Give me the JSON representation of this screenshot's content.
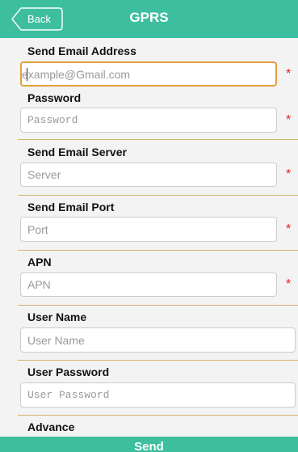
{
  "header": {
    "back_label": "Back",
    "title": "GPRS"
  },
  "form": {
    "send_email_address": {
      "label": "Send Email Address",
      "placeholder": "example@Gmail.com",
      "value": "",
      "required_mark": "*"
    },
    "password": {
      "label": "Password",
      "placeholder": "Password",
      "value": "",
      "required_mark": "*"
    },
    "send_email_server": {
      "label": "Send Email Server",
      "placeholder": "Server",
      "value": "",
      "required_mark": "*"
    },
    "send_email_port": {
      "label": "Send Email Port",
      "placeholder": "Port",
      "value": "",
      "required_mark": "*"
    },
    "apn": {
      "label": "APN",
      "placeholder": "APN",
      "value": "",
      "required_mark": "*"
    },
    "user_name": {
      "label": "User Name",
      "placeholder": "User Name",
      "value": ""
    },
    "user_password": {
      "label": "User Password",
      "placeholder": "User Password",
      "value": ""
    },
    "advance": {
      "label": "Advance"
    }
  },
  "footer": {
    "send_label": "Send"
  },
  "colors": {
    "accent": "#3dbf9f",
    "background": "#f3f3f3",
    "required": "#e02020",
    "focus_border": "#e0a040",
    "divider": "#d6b273"
  },
  "icons": {
    "back": "back-arrow-icon"
  }
}
